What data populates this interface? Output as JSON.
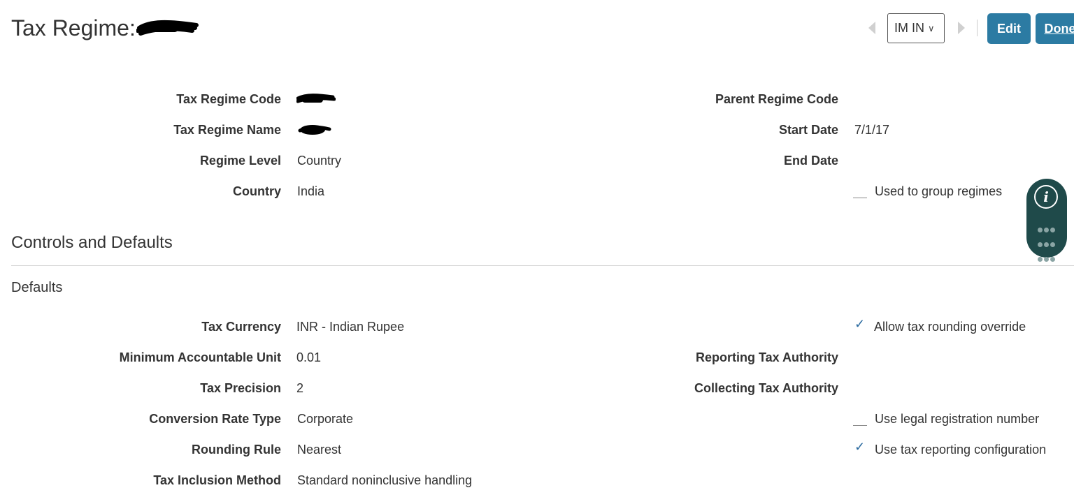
{
  "header": {
    "title_prefix": "Tax Regime:",
    "org_select": {
      "value": "IM IN"
    },
    "edit_label": "Edit",
    "done_label": "Done"
  },
  "regime": {
    "fields_left": [
      {
        "label": "Tax Regime Code",
        "value": ""
      },
      {
        "label": "Tax Regime Name",
        "value": ""
      },
      {
        "label": "Regime Level",
        "value": "Country"
      },
      {
        "label": "Country",
        "value": "India"
      }
    ],
    "fields_right": [
      {
        "label": "Parent Regime Code",
        "value": ""
      },
      {
        "label": "Start Date",
        "value": "7/1/17"
      },
      {
        "label": "End Date",
        "value": ""
      }
    ],
    "used_to_group": {
      "label": "Used to group regimes",
      "checked": false
    }
  },
  "controls": {
    "section_title": "Controls and Defaults",
    "defaults_title": "Defaults",
    "fields_left": [
      {
        "label": "Tax Currency",
        "value": "INR - Indian Rupee"
      },
      {
        "label": "Minimum Accountable Unit",
        "value": "0.01"
      },
      {
        "label": "Tax Precision",
        "value": "2"
      },
      {
        "label": "Conversion Rate Type",
        "value": "Corporate"
      },
      {
        "label": "Rounding Rule",
        "value": "Nearest"
      },
      {
        "label": "Tax Inclusion Method",
        "value": "Standard noninclusive handling"
      }
    ],
    "allow_rounding_override": {
      "label": "Allow tax rounding override",
      "checked": true
    },
    "fields_right": [
      {
        "label": "Reporting Tax Authority",
        "value": ""
      },
      {
        "label": "Collecting Tax Authority",
        "value": ""
      }
    ],
    "use_legal_registration": {
      "label": "Use legal registration number",
      "checked": false
    },
    "use_tax_reporting": {
      "label": "Use tax reporting configuration",
      "checked": true
    }
  },
  "icons": {
    "prev": "chevron-left-icon",
    "next": "chevron-right-icon",
    "info": "info-icon",
    "grid": "grid-icon"
  },
  "colors": {
    "primary_button": "#2c7ba3",
    "checkmark": "#2c6ba0",
    "widget": "#1f4a4a"
  }
}
